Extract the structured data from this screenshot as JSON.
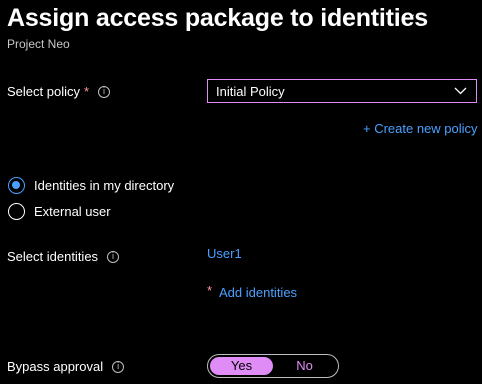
{
  "header": {
    "title": "Assign access package to identities",
    "subtitle": "Project Neo",
    "more_label": "···"
  },
  "policy": {
    "label": "Select policy",
    "required_mark": "*",
    "info": "i",
    "selected": "Initial Policy",
    "create_link": "+ Create new policy"
  },
  "identity_type": {
    "options": [
      {
        "label": "Identities in my directory",
        "selected": true
      },
      {
        "label": "External user",
        "selected": false
      }
    ]
  },
  "identities": {
    "label": "Select identities",
    "info": "i",
    "selected_user": "User1",
    "required_mark": "*",
    "add_link": "Add identities"
  },
  "bypass": {
    "label": "Bypass approval",
    "info": "i",
    "yes_label": "Yes",
    "no_label": "No",
    "value": "Yes"
  },
  "colors": {
    "background": "#000000",
    "accent_link": "#4aa0ff",
    "focus_border": "#e08cf6",
    "required": "#ff99a4"
  }
}
